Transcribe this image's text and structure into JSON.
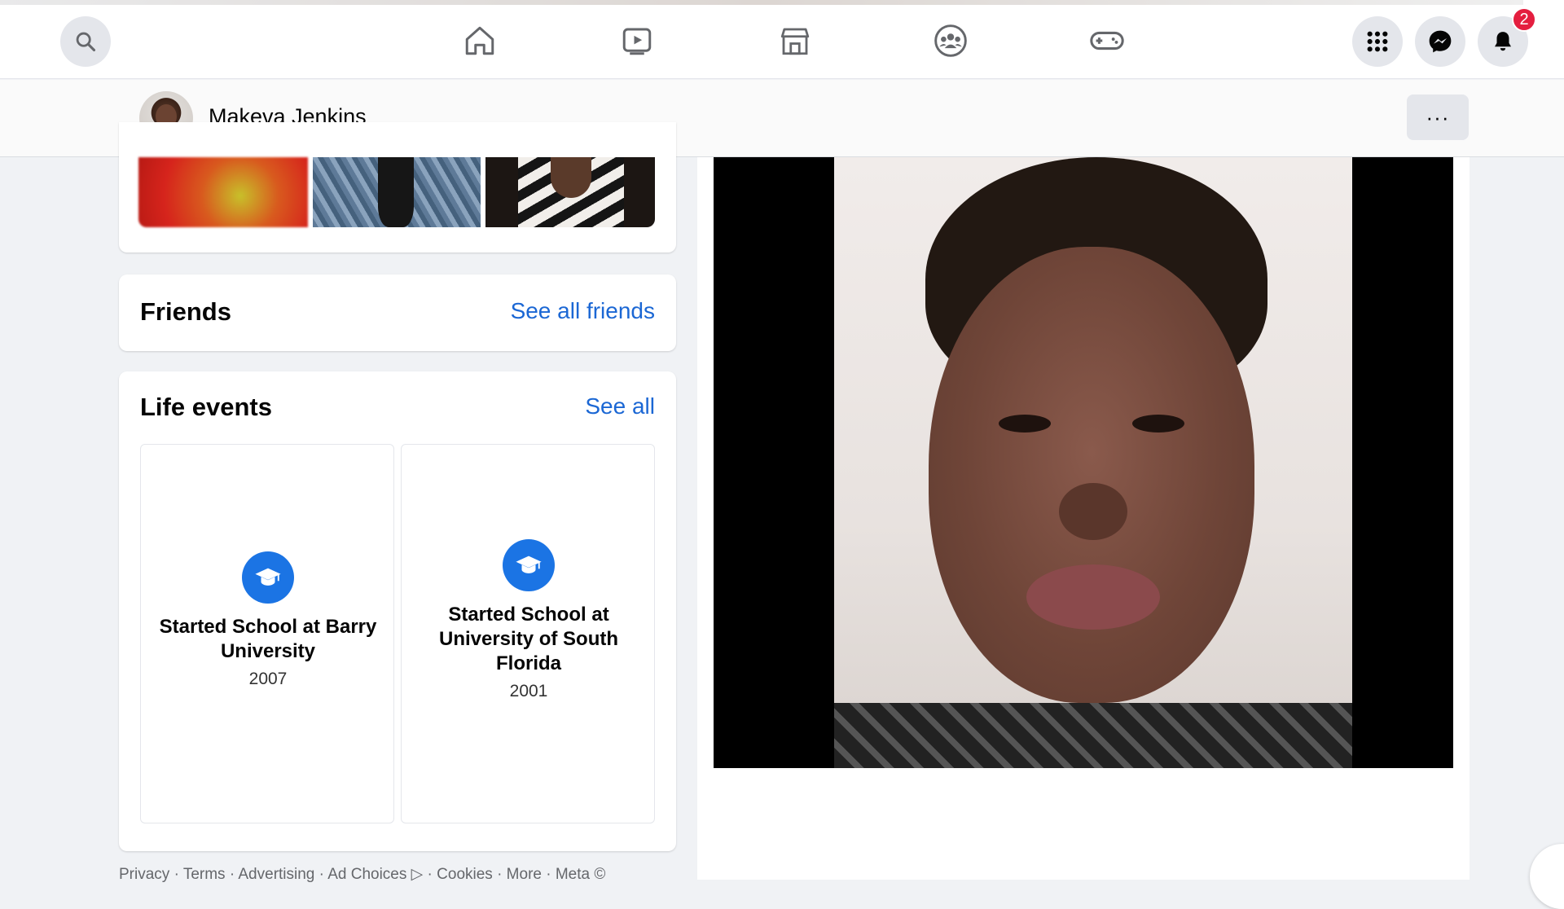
{
  "nav": {
    "icons": [
      "search-icon",
      "home-icon",
      "watch-icon",
      "marketplace-icon",
      "groups-icon",
      "gaming-icon",
      "menu-grid-icon",
      "messenger-icon",
      "bell-icon"
    ],
    "notification_count": "2"
  },
  "profile": {
    "name": "Makeva Jenkins",
    "more_label": "···"
  },
  "friends": {
    "title": "Friends",
    "link": "See all friends"
  },
  "life_events": {
    "title": "Life events",
    "link": "See all",
    "items": [
      {
        "title": "Started School at Barry University",
        "year": "2007",
        "icon": "graduation-cap-icon"
      },
      {
        "title": "Started School at University of South Florida",
        "year": "2001",
        "icon": "graduation-cap-icon"
      }
    ]
  },
  "footer": {
    "text": "Privacy · Terms · Advertising · Ad Choices ▷ · Cookies · More · Meta ©"
  },
  "colors": {
    "accent": "#1b74e4",
    "link": "#1b67d4",
    "badge": "#e41e3f"
  }
}
